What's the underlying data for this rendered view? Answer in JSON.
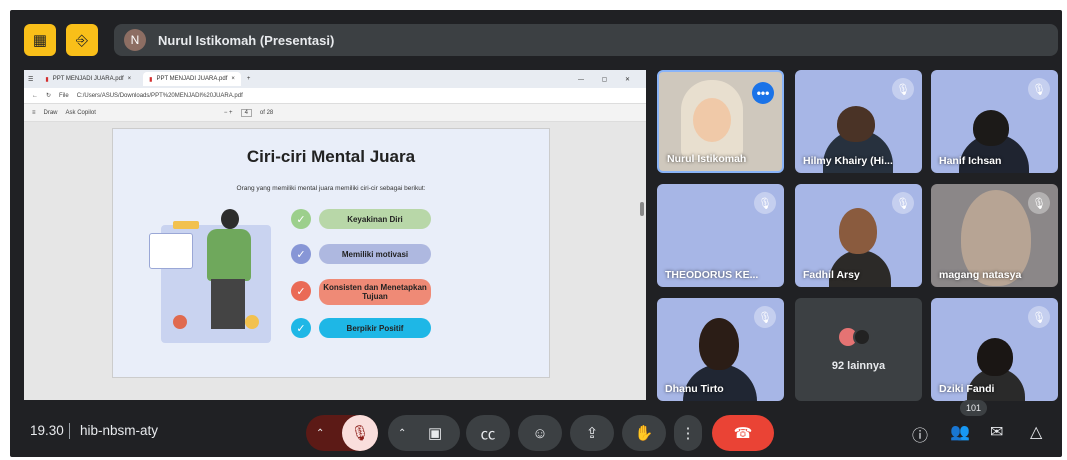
{
  "header": {
    "presenter_initial": "N",
    "presenter_title": "Nurul Istikomah (Presentasi)"
  },
  "browser": {
    "tabs": [
      "PPT MENJADI JUARA.pdf",
      "PPT MENJADI JUARA.pdf"
    ],
    "address_prefix": "File",
    "address": "C:/Users/ASUS/Downloads/PPT%20MENJADI%20JUARA.pdf",
    "pdf_toolbar": {
      "draw": "Draw",
      "ask": "Ask Copilot",
      "page": "4",
      "of": "of 28"
    }
  },
  "slide": {
    "title": "Ciri-ciri Mental Juara",
    "subtitle": "Orang yang memiliki mental juara memiliki ciri-cir sebagai berikut:",
    "items": [
      "Keyakinan Diri",
      "Memiliki motivasi",
      "Konsisten dan Menetapkan Tujuan",
      "Berpikir Positif"
    ],
    "colors": [
      "#b8d7a8",
      "#aeb8e0",
      "#ef8a76",
      "#1eb7e6"
    ]
  },
  "participants": [
    {
      "name": "Nurul Istikomah"
    },
    {
      "name": "Hilmy Khairy (Hi..."
    },
    {
      "name": "Hanif Ichsan"
    },
    {
      "name": "THEODORUS KE..."
    },
    {
      "name": "Fadhil Arsy"
    },
    {
      "name": "magang natasya"
    },
    {
      "name": "Dhanu Tirto"
    },
    {
      "name": "92 lainnya"
    },
    {
      "name": "Dziki Fandi"
    }
  ],
  "footer": {
    "time": "19.30",
    "meeting_code": "hib-nbsm-aty",
    "people_count": "101"
  }
}
